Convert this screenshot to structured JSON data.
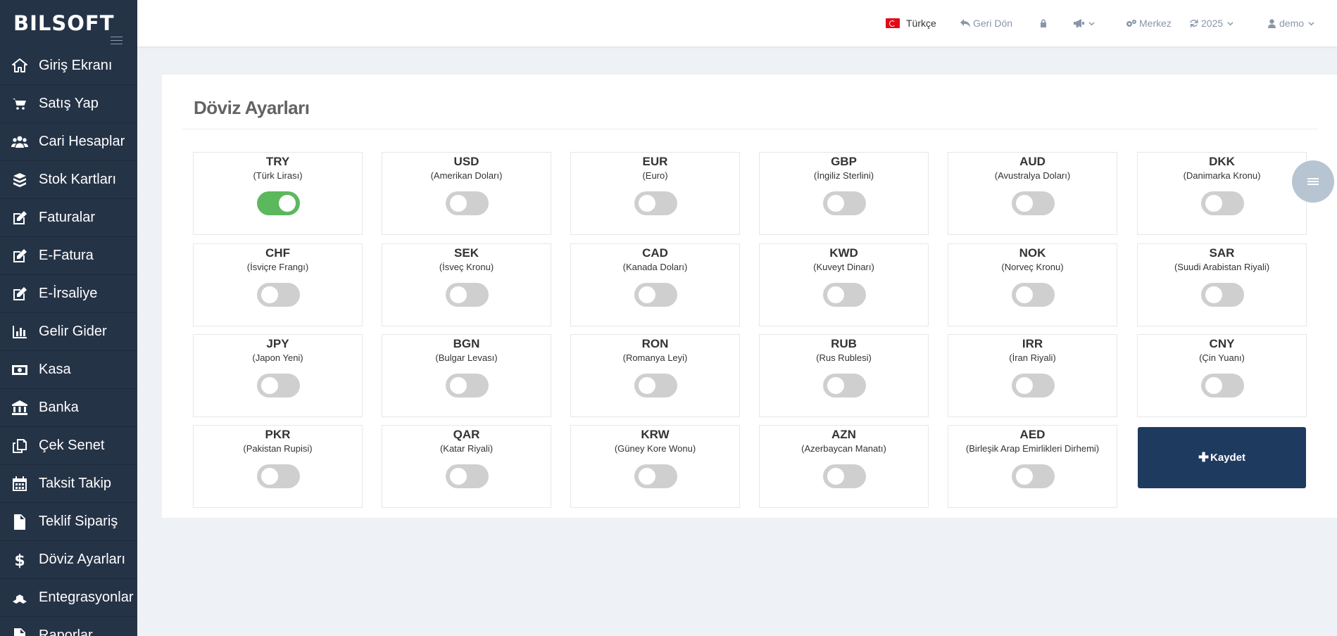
{
  "brand": {
    "logo": "BILSOFT"
  },
  "sidebar": {
    "items": [
      {
        "label": "Giriş Ekranı",
        "icon": "home-icon"
      },
      {
        "label": "Satış Yap",
        "icon": "cart-icon"
      },
      {
        "label": "Cari Hesaplar",
        "icon": "users-icon"
      },
      {
        "label": "Stok Kartları",
        "icon": "boxes-icon"
      },
      {
        "label": "Faturalar",
        "icon": "edit-icon"
      },
      {
        "label": "E-Fatura",
        "icon": "edit-icon"
      },
      {
        "label": "E-İrsaliye",
        "icon": "edit-icon"
      },
      {
        "label": "Gelir Gider",
        "icon": "bar-chart-icon"
      },
      {
        "label": "Kasa",
        "icon": "money-icon"
      },
      {
        "label": "Banka",
        "icon": "bank-icon"
      },
      {
        "label": "Çek Senet",
        "icon": "copy-icon"
      },
      {
        "label": "Taksit Takip",
        "icon": "calendar-icon"
      },
      {
        "label": "Teklif Sipariş",
        "icon": "file-icon"
      },
      {
        "label": "Döviz Ayarları",
        "icon": "dollar-icon"
      },
      {
        "label": "Entegrasyonlar",
        "icon": "cubes-icon"
      },
      {
        "label": "Raporlar",
        "icon": "file-icon"
      }
    ]
  },
  "header": {
    "language": "Türkçe",
    "back": "Geri Dön",
    "branch": "Merkez",
    "year": "2025",
    "user": "demo"
  },
  "page": {
    "title": "Döviz Ayarları",
    "save_label": "Kaydet"
  },
  "currencies": [
    {
      "code": "TRY",
      "name": "(Türk Lirası)",
      "enabled": true
    },
    {
      "code": "USD",
      "name": "(Amerikan Doları)",
      "enabled": false
    },
    {
      "code": "EUR",
      "name": "(Euro)",
      "enabled": false
    },
    {
      "code": "GBP",
      "name": "(İngiliz Sterlini)",
      "enabled": false
    },
    {
      "code": "AUD",
      "name": "(Avustralya Doları)",
      "enabled": false
    },
    {
      "code": "DKK",
      "name": "(Danimarka Kronu)",
      "enabled": false
    },
    {
      "code": "CHF",
      "name": "(İsviçre Frangı)",
      "enabled": false
    },
    {
      "code": "SEK",
      "name": "(İsveç Kronu)",
      "enabled": false
    },
    {
      "code": "CAD",
      "name": "(Kanada Doları)",
      "enabled": false
    },
    {
      "code": "KWD",
      "name": "(Kuveyt Dinarı)",
      "enabled": false
    },
    {
      "code": "NOK",
      "name": "(Norveç Kronu)",
      "enabled": false
    },
    {
      "code": "SAR",
      "name": "(Suudi Arabistan Riyali)",
      "enabled": false
    },
    {
      "code": "JPY",
      "name": "(Japon Yeni)",
      "enabled": false
    },
    {
      "code": "BGN",
      "name": "(Bulgar Levası)",
      "enabled": false
    },
    {
      "code": "RON",
      "name": "(Romanya Leyi)",
      "enabled": false
    },
    {
      "code": "RUB",
      "name": "(Rus Rublesi)",
      "enabled": false
    },
    {
      "code": "IRR",
      "name": "(İran Riyali)",
      "enabled": false
    },
    {
      "code": "CNY",
      "name": "(Çin Yuanı)",
      "enabled": false
    },
    {
      "code": "PKR",
      "name": "(Pakistan Rupisi)",
      "enabled": false
    },
    {
      "code": "QAR",
      "name": "(Katar Riyali)",
      "enabled": false
    },
    {
      "code": "KRW",
      "name": "(Güney Kore Wonu)",
      "enabled": false
    },
    {
      "code": "AZN",
      "name": "(Azerbaycan Manatı)",
      "enabled": false
    },
    {
      "code": "AED",
      "name": "(Birleşik Arap Emirlikleri Dirhemi)",
      "enabled": false
    }
  ],
  "colors": {
    "sidebar": "#253347",
    "toggle_on": "#5cb85c",
    "toggle_off": "#cfcfcf",
    "save_button": "#1f3a5f"
  }
}
